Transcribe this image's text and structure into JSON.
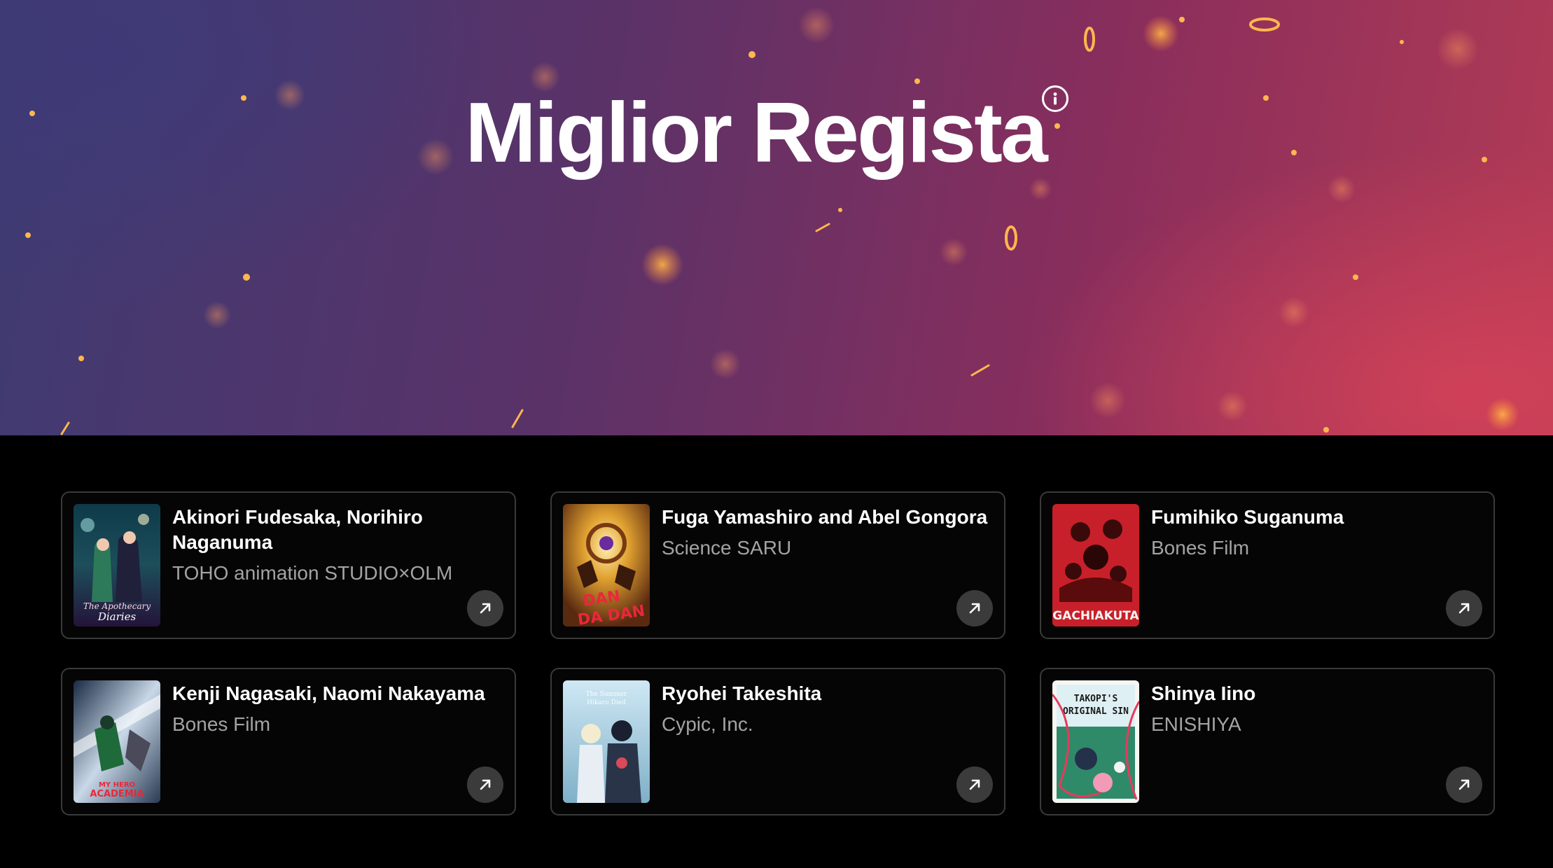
{
  "hero": {
    "title": "Miglior Regista",
    "info_icon": "info-icon"
  },
  "nominees": [
    {
      "name": "Akinori Fudesaka, Norihiro Naganuma",
      "studio": "TOHO animation STUDIO×OLM",
      "poster_text": "The Apothecary Diaries"
    },
    {
      "name": "Fuga Yamashiro and Abel Gongora",
      "studio": "Science SARU",
      "poster_text": "DAN DA DAN"
    },
    {
      "name": "Fumihiko Suganuma",
      "studio": "Bones Film",
      "poster_text": "GACHIAKUTA"
    },
    {
      "name": "Kenji Nagasaki, Naomi Nakayama",
      "studio": "Bones Film",
      "poster_text": "MY HERO ACADEMIA"
    },
    {
      "name": "Ryohei Takeshita",
      "studio": "Cypic, Inc.",
      "poster_text": "The Summer Hikaru Died"
    },
    {
      "name": "Shinya Iino",
      "studio": "ENISHIYA",
      "poster_text": "TAKOPI'S ORIGINAL SIN"
    }
  ],
  "icons": {
    "open": "arrow-up-right-icon"
  }
}
